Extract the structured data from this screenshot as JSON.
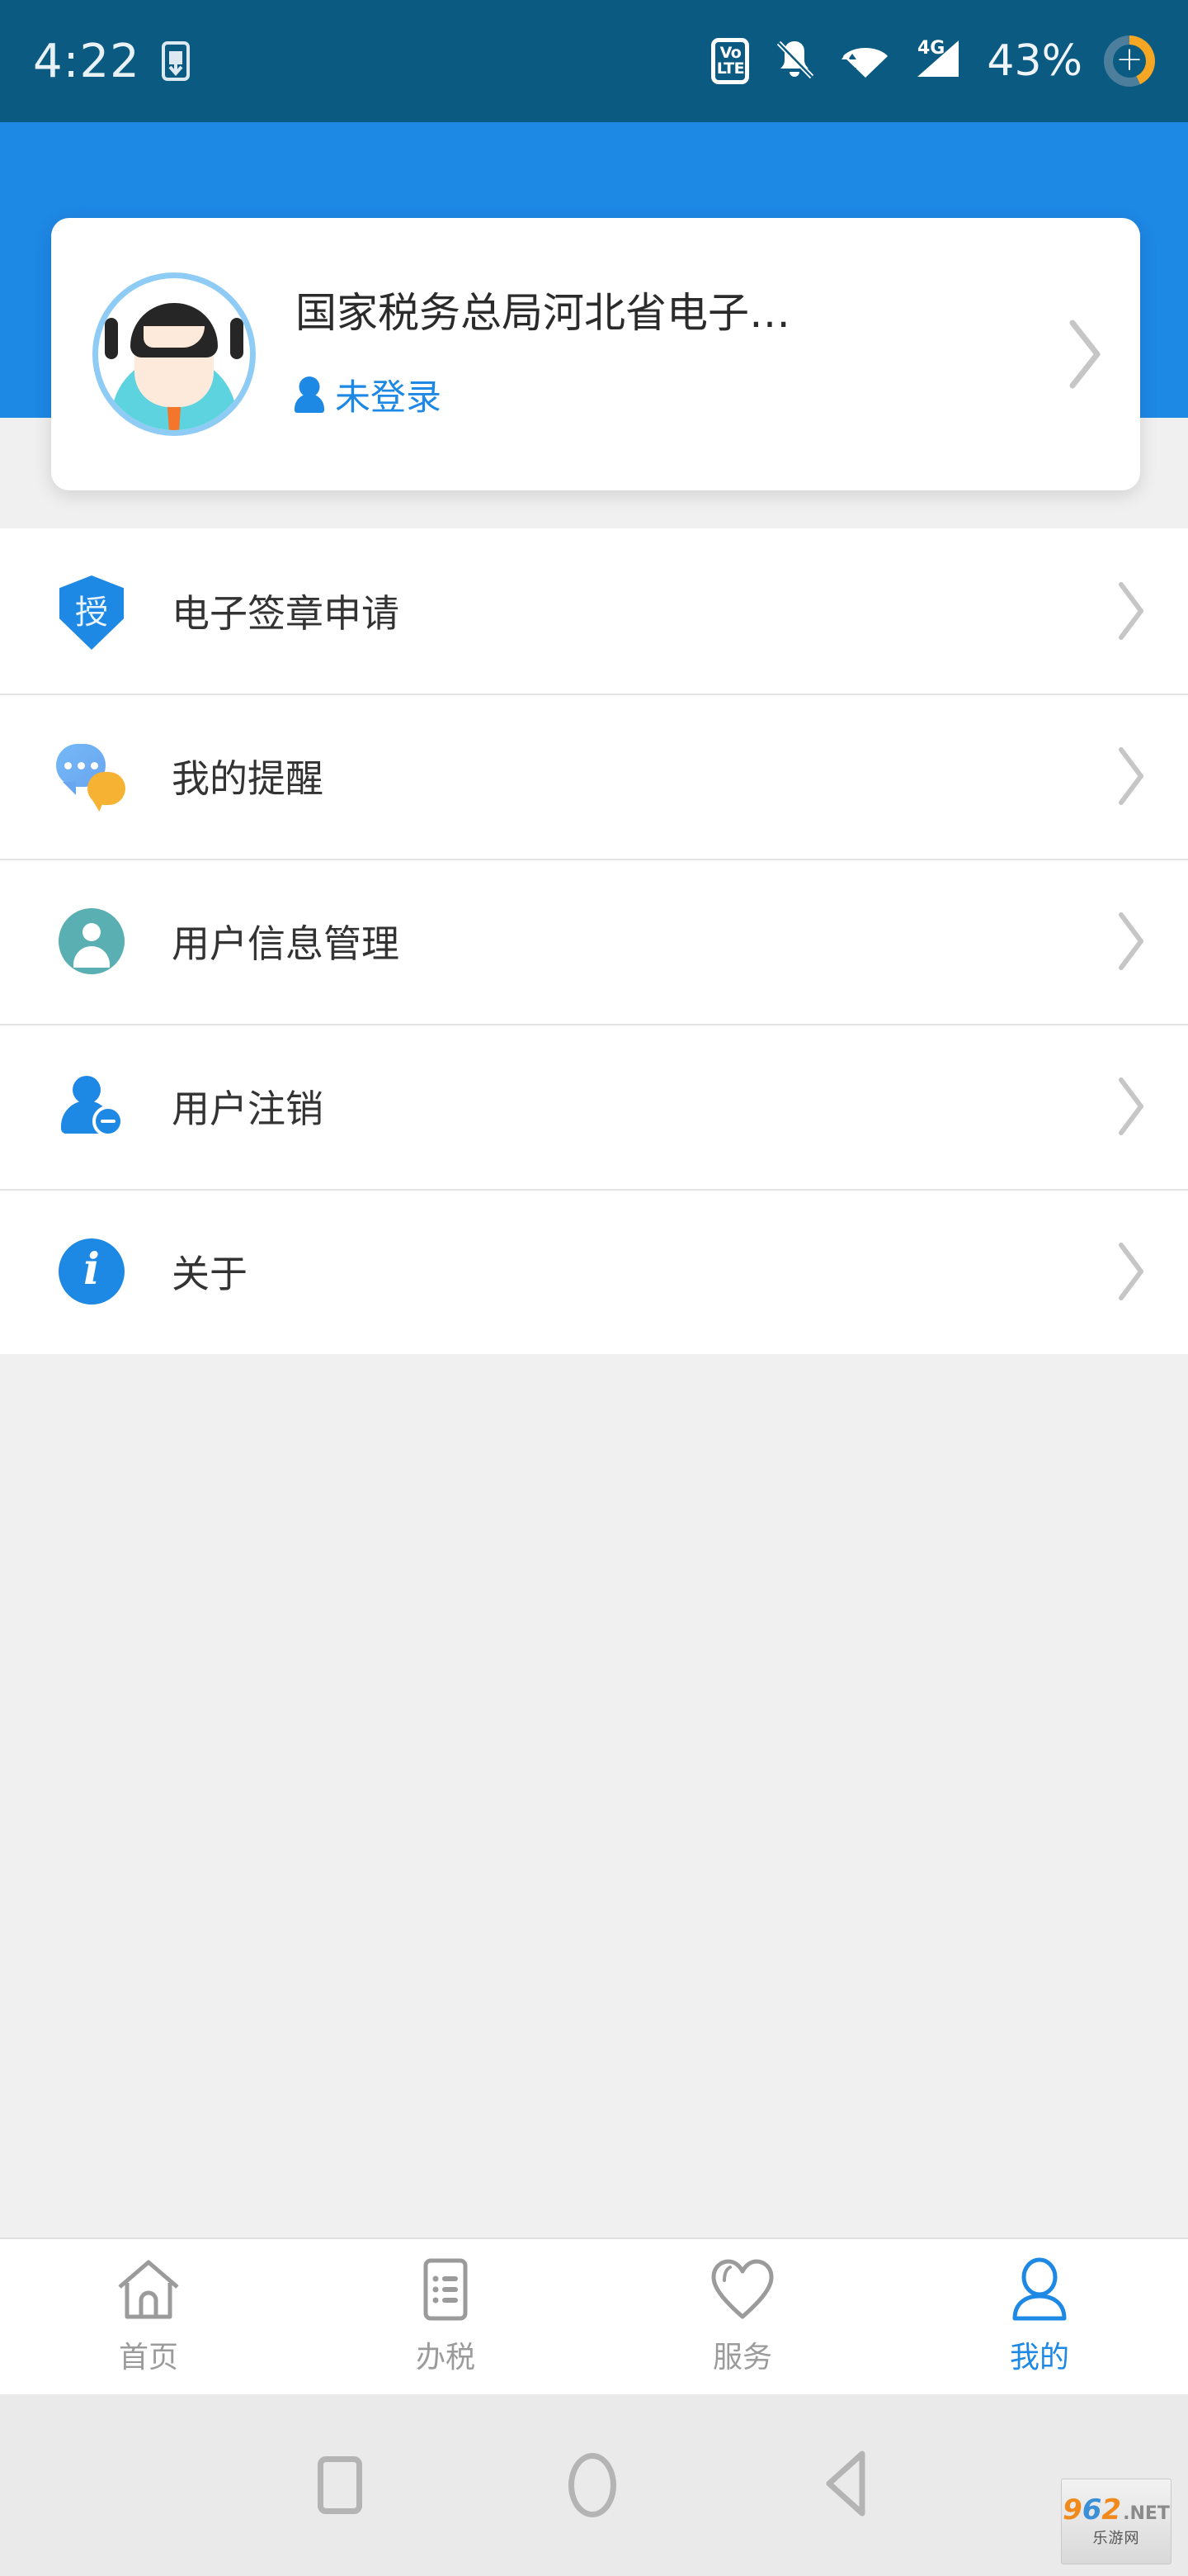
{
  "statusbar": {
    "time": "4:22",
    "cast_icon": "phone-download-icon",
    "volte_line1": "Vo",
    "volte_line2": "LTE",
    "notification_icon": "bell-off-icon",
    "wifi_icon": "wifi-icon",
    "network_label": "4G",
    "signal_icon": "signal-bars-icon",
    "battery_percent": "43%",
    "battery_icon": "battery-charging-ring-icon"
  },
  "profile": {
    "title": "国家税务总局河北省电子…",
    "login_status": "未登录",
    "user_icon": "person-icon",
    "chevron": "chevron-right-icon",
    "avatar_icon": "user-avatar-illustration"
  },
  "menu": {
    "items": [
      {
        "label": "电子签章申请",
        "icon": "shield-seal-icon",
        "icon_char": "授"
      },
      {
        "label": "我的提醒",
        "icon": "chat-bubbles-icon"
      },
      {
        "label": "用户信息管理",
        "icon": "user-circle-icon"
      },
      {
        "label": "用户注销",
        "icon": "user-minus-icon"
      },
      {
        "label": "关于",
        "icon": "info-circle-icon",
        "icon_char": "i"
      }
    ]
  },
  "tabbar": {
    "items": [
      {
        "label": "首页",
        "icon": "home-icon",
        "active": false
      },
      {
        "label": "办税",
        "icon": "list-doc-icon",
        "active": false
      },
      {
        "label": "服务",
        "icon": "heart-icon",
        "active": false
      },
      {
        "label": "我的",
        "icon": "person-icon",
        "active": true
      }
    ]
  },
  "androidnav": {
    "recents_icon": "square-icon",
    "home_icon": "circle-icon",
    "back_icon": "triangle-left-icon"
  },
  "watermark": {
    "d1": "9",
    "d2": "6",
    "d3": "2",
    "tld": ".NET",
    "cn": "乐游网"
  },
  "colors": {
    "statusbar_bg": "#0a5a82",
    "header_blue": "#1e88e5",
    "accent": "#1e88e5",
    "page_bg": "#f0f0f0",
    "text": "#333333",
    "muted": "#9b9b9b",
    "battery_orange": "#f5a623",
    "teal": "#5aafb2"
  }
}
